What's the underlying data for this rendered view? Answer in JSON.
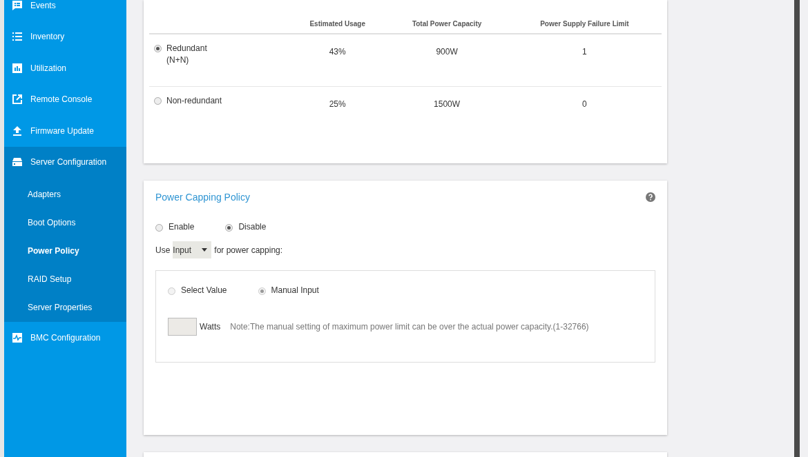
{
  "sidebar": {
    "items": [
      {
        "label": "Events",
        "selected": false
      },
      {
        "label": "Inventory",
        "selected": false
      },
      {
        "label": "Utilization",
        "selected": false
      },
      {
        "label": "Remote Console",
        "selected": false
      },
      {
        "label": "Firmware Update",
        "selected": false
      },
      {
        "label": "Server Configuration",
        "selected": false,
        "expanded": true,
        "children": [
          {
            "label": "Adapters",
            "selected": false
          },
          {
            "label": "Boot Options",
            "selected": false
          },
          {
            "label": "Power Policy",
            "selected": true
          },
          {
            "label": "RAID Setup",
            "selected": false
          },
          {
            "label": "Server Properties",
            "selected": false
          }
        ]
      },
      {
        "label": "BMC Configuration",
        "selected": false
      }
    ]
  },
  "redundancy_table": {
    "columns": [
      "Estimated Usage",
      "Total Power Capacity",
      "Power Supply Failure Limit"
    ],
    "rows": [
      {
        "name": [
          "Redundant",
          "(N+N)"
        ],
        "selected": true,
        "cells": [
          "43%",
          "900W",
          "1"
        ]
      },
      {
        "name": [
          "Non-redundant"
        ],
        "selected": false,
        "cells": [
          "25%",
          "1500W",
          "0"
        ]
      }
    ]
  },
  "power_capping": {
    "title": "Power Capping Policy",
    "mode": [
      {
        "label": "Enable",
        "selected": false
      },
      {
        "label": "Disable",
        "selected": true
      }
    ],
    "use_prefix": "Use",
    "use_select": "Input",
    "use_suffix": "for power capping:",
    "value_source": [
      {
        "label": "Select Value",
        "selected": false
      },
      {
        "label": "Manual Input",
        "selected": true
      }
    ],
    "watts_label": "Watts",
    "note": "Note:The manual setting of maximum power limit can be over the actual power capacity.(1-32766)"
  }
}
